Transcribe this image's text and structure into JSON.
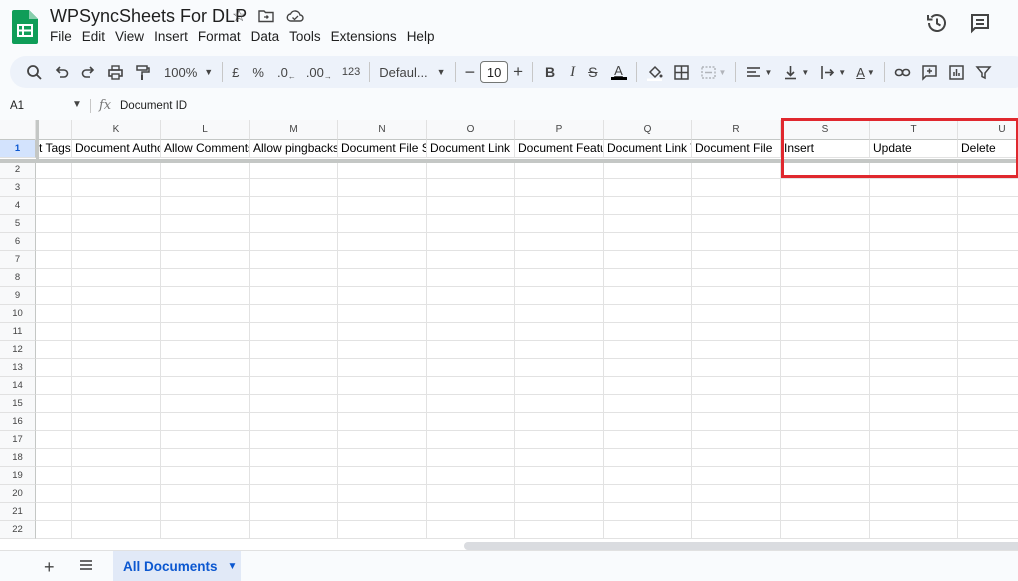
{
  "app": {
    "title": "WPSyncSheets For DLP",
    "menu": [
      "File",
      "Edit",
      "View",
      "Insert",
      "Format",
      "Data",
      "Tools",
      "Extensions",
      "Help"
    ]
  },
  "toolbar": {
    "zoom": "100%",
    "currency": "£",
    "percent": "%",
    "decrease_decimal": ".0",
    "increase_decimal": ".00",
    "number_format": "123",
    "font": "Defaul...",
    "font_size": "10"
  },
  "formula_bar": {
    "cell_ref": "A1",
    "fx": "fx",
    "value": "Document ID"
  },
  "grid": {
    "columns": [
      "",
      "K",
      "L",
      "M",
      "N",
      "O",
      "P",
      "Q",
      "R",
      "S",
      "T",
      "U"
    ],
    "header_row": [
      "t Tags",
      "Document Autho",
      "Allow Comments",
      "Allow pingbacks",
      "Document File S",
      "Document Link",
      "Document Featu",
      "Document Link T",
      "Document File",
      "Insert",
      "Update",
      "Delete"
    ],
    "row_numbers": [
      "1",
      "2",
      "3",
      "4",
      "5",
      "6",
      "7",
      "8",
      "9",
      "10",
      "11",
      "12",
      "13",
      "14",
      "15",
      "16",
      "17",
      "18",
      "19",
      "20",
      "21",
      "22"
    ]
  },
  "sheet": {
    "add": "+",
    "tab": "All Documents"
  },
  "colors": {
    "accent": "#0b57d0",
    "highlight": "#e0282e",
    "sheets_green": "#0f9d58"
  }
}
